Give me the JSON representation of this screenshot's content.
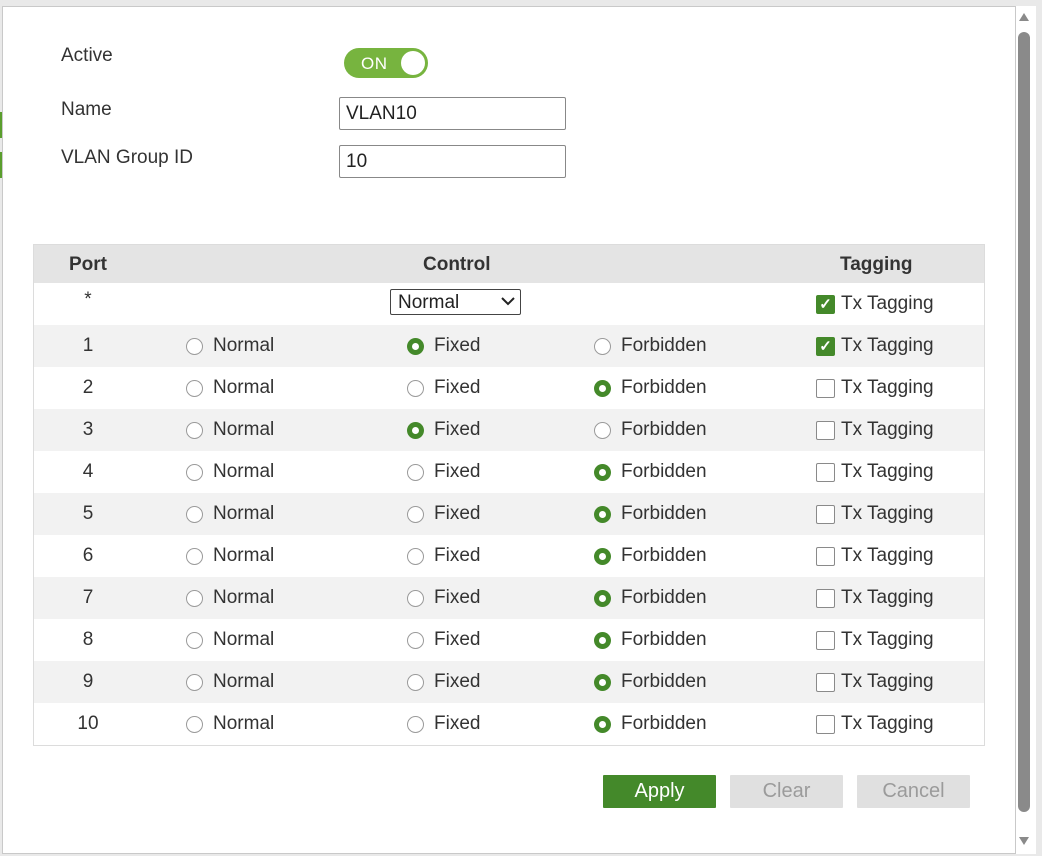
{
  "form": {
    "active_label": "Active",
    "active_toggle": "ON",
    "name_label": "Name",
    "name_value": "VLAN10",
    "group_label": "VLAN Group ID",
    "group_value": "10"
  },
  "table": {
    "headers": {
      "port": "Port",
      "control": "Control",
      "tagging": "Tagging"
    },
    "all_row": {
      "port": "*",
      "control_select": "Normal",
      "tx_label": "Tx Tagging",
      "tx_checked": true
    },
    "option_labels": {
      "normal": "Normal",
      "fixed": "Fixed",
      "forbidden": "Forbidden",
      "tx": "Tx Tagging"
    },
    "rows": [
      {
        "port": "1",
        "control": "fixed",
        "tx": true
      },
      {
        "port": "2",
        "control": "forbidden",
        "tx": false
      },
      {
        "port": "3",
        "control": "fixed",
        "tx": false
      },
      {
        "port": "4",
        "control": "forbidden",
        "tx": false
      },
      {
        "port": "5",
        "control": "forbidden",
        "tx": false
      },
      {
        "port": "6",
        "control": "forbidden",
        "tx": false
      },
      {
        "port": "7",
        "control": "forbidden",
        "tx": false
      },
      {
        "port": "8",
        "control": "forbidden",
        "tx": false
      },
      {
        "port": "9",
        "control": "forbidden",
        "tx": false
      },
      {
        "port": "10",
        "control": "forbidden",
        "tx": false
      }
    ]
  },
  "buttons": {
    "apply": "Apply",
    "clear": "Clear",
    "cancel": "Cancel"
  },
  "colors": {
    "accent": "#44892a",
    "toggle": "#77b43f",
    "button_disabled": "#e0e0e0"
  }
}
